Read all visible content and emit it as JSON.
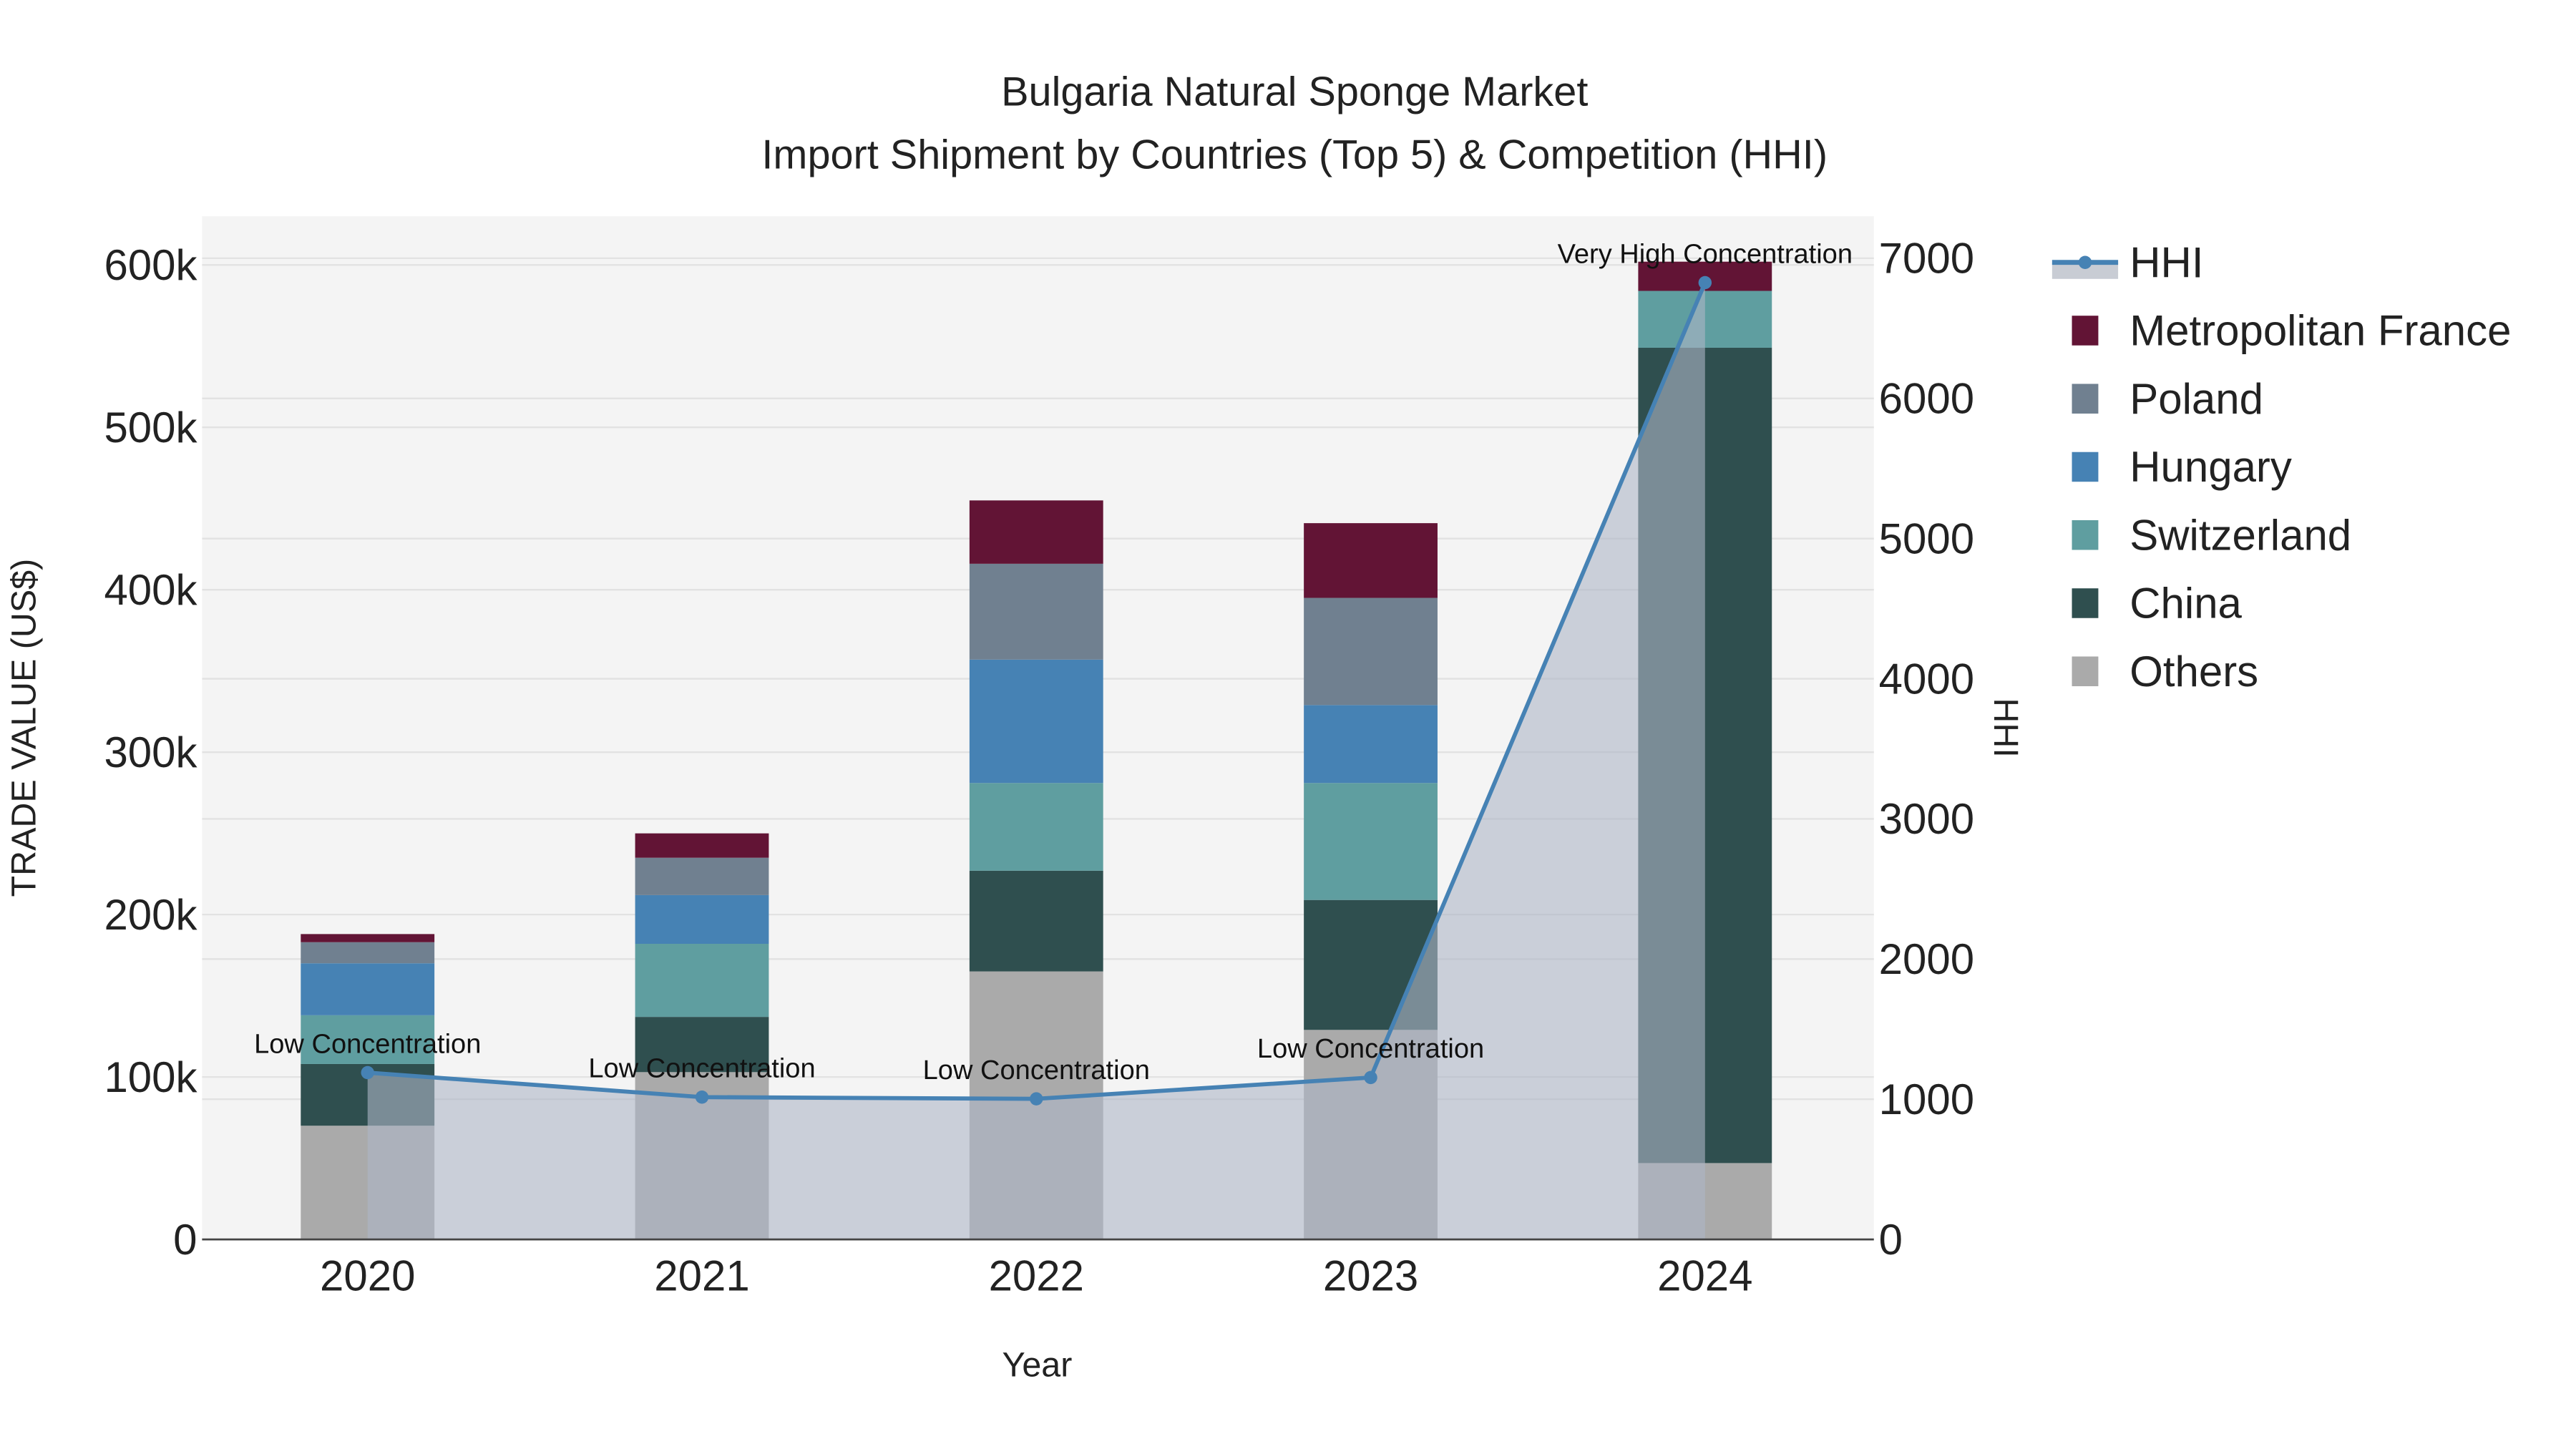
{
  "chart_data": {
    "type": "bar",
    "stacked": true,
    "title": "Bulgaria Natural Sponge Market",
    "subtitle": "Import Shipment by Countries (Top 5) & Competition (HHI)",
    "xlabel": "Year",
    "ylabel": "TRADE VALUE (US$)",
    "y2label": "HHI",
    "categories": [
      "2020",
      "2021",
      "2022",
      "2023",
      "2024"
    ],
    "ylim": [
      0,
      630000
    ],
    "y2lim": [
      0,
      7300
    ],
    "yticks": [
      0,
      100000,
      200000,
      300000,
      400000,
      500000,
      600000
    ],
    "ytick_labels": [
      "0",
      "100k",
      "200k",
      "300k",
      "400k",
      "500k",
      "600k"
    ],
    "y2ticks": [
      0,
      1000,
      2000,
      3000,
      4000,
      5000,
      6000,
      7000
    ],
    "y2tick_labels": [
      "0",
      "1000",
      "2000",
      "3000",
      "4000",
      "5000",
      "6000",
      "7000"
    ],
    "grid": true,
    "legend_position": "right",
    "series": [
      {
        "name": "Others",
        "color": "#aaaaaa",
        "values": [
          70000,
          103000,
          165000,
          129000,
          47000
        ]
      },
      {
        "name": "China",
        "color": "#2f4f4f",
        "values": [
          38000,
          34000,
          62000,
          80000,
          502000
        ]
      },
      {
        "name": "Switzerland",
        "color": "#5f9ea0",
        "values": [
          30000,
          45000,
          54000,
          72000,
          35000
        ]
      },
      {
        "name": "Hungary",
        "color": "#4682b4",
        "values": [
          32000,
          30000,
          76000,
          48000,
          0
        ]
      },
      {
        "name": "Poland",
        "color": "#708090",
        "values": [
          13000,
          23000,
          59000,
          66000,
          0
        ]
      },
      {
        "name": "Metropolitan France",
        "color": "#621435",
        "values": [
          5000,
          15000,
          39000,
          46000,
          18000
        ]
      }
    ],
    "line": {
      "name": "HHI",
      "color": "#4682b4",
      "values": [
        1190,
        1015,
        1003,
        1155,
        6826
      ],
      "annotations": [
        "Low Concentration",
        "Low Concentration",
        "Low Concentration",
        "Low Concentration",
        "Very High Concentration"
      ]
    },
    "legend_order": [
      "HHI",
      "Metropolitan France",
      "Poland",
      "Hungary",
      "Switzerland",
      "China",
      "Others"
    ]
  }
}
